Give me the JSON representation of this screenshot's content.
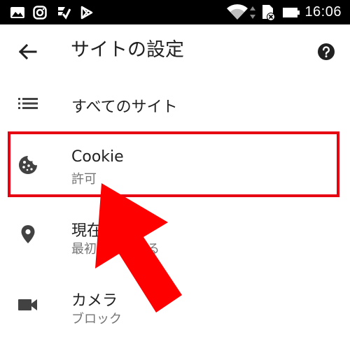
{
  "status_bar": {
    "time": "16:06",
    "icons": [
      "gallery-icon",
      "instagram-icon",
      "tasks-check-icon",
      "play-store-icon",
      "wifi-icon",
      "sd-card-icon",
      "battery-icon"
    ]
  },
  "header": {
    "title": "サイトの設定",
    "back_icon": "arrow-back-icon",
    "help_icon": "help-circle-icon"
  },
  "settings": {
    "all_sites": {
      "label": "すべてのサイト",
      "icon": "list-icon"
    },
    "cookie": {
      "label": "Cookie",
      "status": "許可",
      "icon": "cookie-icon"
    },
    "location": {
      "label": "現在",
      "status": "最初に確認する",
      "icon": "location-pin-icon"
    },
    "camera": {
      "label": "カメラ",
      "status": "ブロック",
      "icon": "videocam-icon"
    }
  },
  "annotation": {
    "highlight_color": "#e60012",
    "arrow_color": "#ff0000"
  }
}
